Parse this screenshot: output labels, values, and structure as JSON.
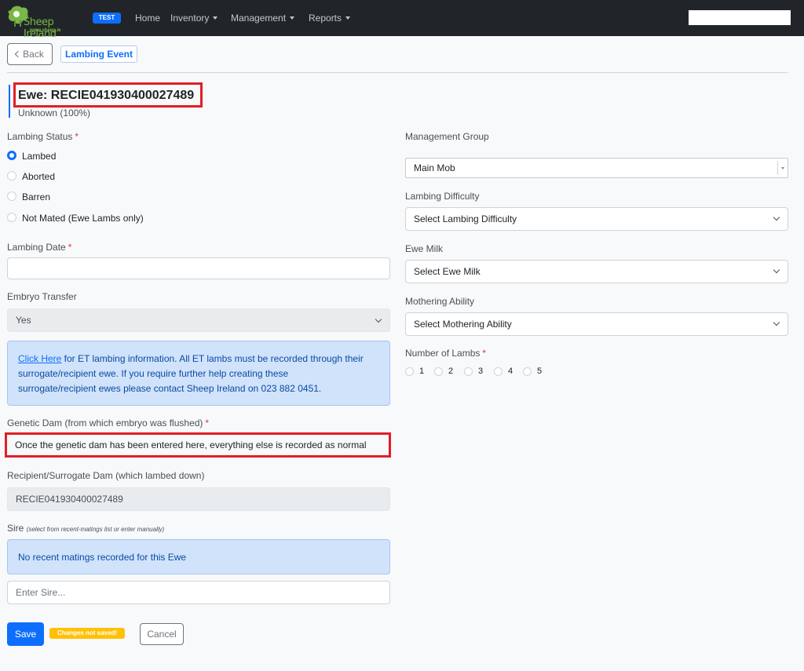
{
  "navbar": {
    "logo_text": "Sheep Ireland",
    "logo_url": "www.sheep.ie",
    "env_badge": "TEST",
    "links": {
      "home": "Home",
      "inventory": "Inventory",
      "management": "Management",
      "reports": "Reports"
    }
  },
  "toolbar": {
    "back_label": "Back",
    "active_tab": "Lambing Event"
  },
  "ewe": {
    "title": "Ewe: RECIE041930400027489",
    "breed": "Unknown (100%)"
  },
  "form": {
    "lambing_status": {
      "label": "Lambing Status",
      "options": [
        "Lambed",
        "Aborted",
        "Barren",
        "Not Mated (Ewe Lambs only)"
      ],
      "selected": "Lambed"
    },
    "lambing_date": {
      "label": "Lambing Date",
      "value": ""
    },
    "embryo_transfer": {
      "label": "Embryo Transfer",
      "value": "Yes"
    },
    "et_info": {
      "link_text": "Click Here",
      "text_line1": " for ET lambing information. All ET lambs must be recorded through their",
      "text_line2": "surrogate/recipient ewe. If you require further help creating these",
      "text_line3": "surrogate/recipient ewes please contact Sheep Ireland on 023 882 0451."
    },
    "genetic_dam": {
      "label": "Genetic Dam (from which embryo was flushed)",
      "value": "Once the genetic dam has been entered here, everything else is recorded as normal"
    },
    "recipient_dam": {
      "label": "Recipient/Surrogate Dam (which lambed down)",
      "value": "RECIE041930400027489"
    },
    "sire": {
      "label": "Sire",
      "hint": "(select from recent-matings list or enter manually)",
      "no_matings": "No recent matings recorded for this Ewe",
      "placeholder": "Enter Sire..."
    },
    "management_group": {
      "label": "Management Group",
      "value": "Main Mob"
    },
    "lambing_difficulty": {
      "label": "Lambing Difficulty",
      "value": "Select Lambing Difficulty"
    },
    "ewe_milk": {
      "label": "Ewe Milk",
      "value": "Select Ewe Milk"
    },
    "mothering_ability": {
      "label": "Mothering Ability",
      "value": "Select Mothering Ability"
    },
    "number_of_lambs": {
      "label": "Number of Lambs",
      "options": [
        "1",
        "2",
        "3",
        "4",
        "5"
      ]
    }
  },
  "actions": {
    "save": "Save",
    "unsaved": "Changes not saved!",
    "cancel": "Cancel"
  },
  "colors": {
    "primary": "#0d6efd",
    "navbar": "#212529",
    "required": "#dc3545",
    "warning": "#ffc107",
    "highlight": "#e01f26"
  }
}
